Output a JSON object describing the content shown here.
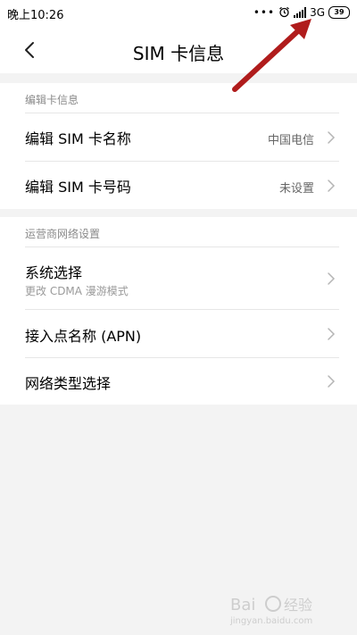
{
  "status_bar": {
    "time": "晚上10:26",
    "dots": "•••",
    "network": "3G",
    "battery": "39",
    "icons": [
      "alarm-icon",
      "signal-icon"
    ]
  },
  "header": {
    "title": "SIM  卡信息",
    "back_icon": "chevron-left-icon"
  },
  "section1": {
    "title": "编辑卡信息",
    "rows": [
      {
        "label": "编辑 SIM 卡名称",
        "value": "中国电信"
      },
      {
        "label": "编辑 SIM 卡号码",
        "value": "未设置"
      }
    ]
  },
  "section2": {
    "title": "运营商网络设置",
    "rows": [
      {
        "label": "系统选择",
        "subtitle": "更改 CDMA 漫游模式"
      },
      {
        "label": "接入点名称 (APN)"
      },
      {
        "label": "网络类型选择"
      }
    ]
  },
  "watermark": {
    "text": "jingyan.baidu.com"
  },
  "colors": {
    "accent_arrow": "#b01c1c",
    "background": "#f3f3f3"
  }
}
